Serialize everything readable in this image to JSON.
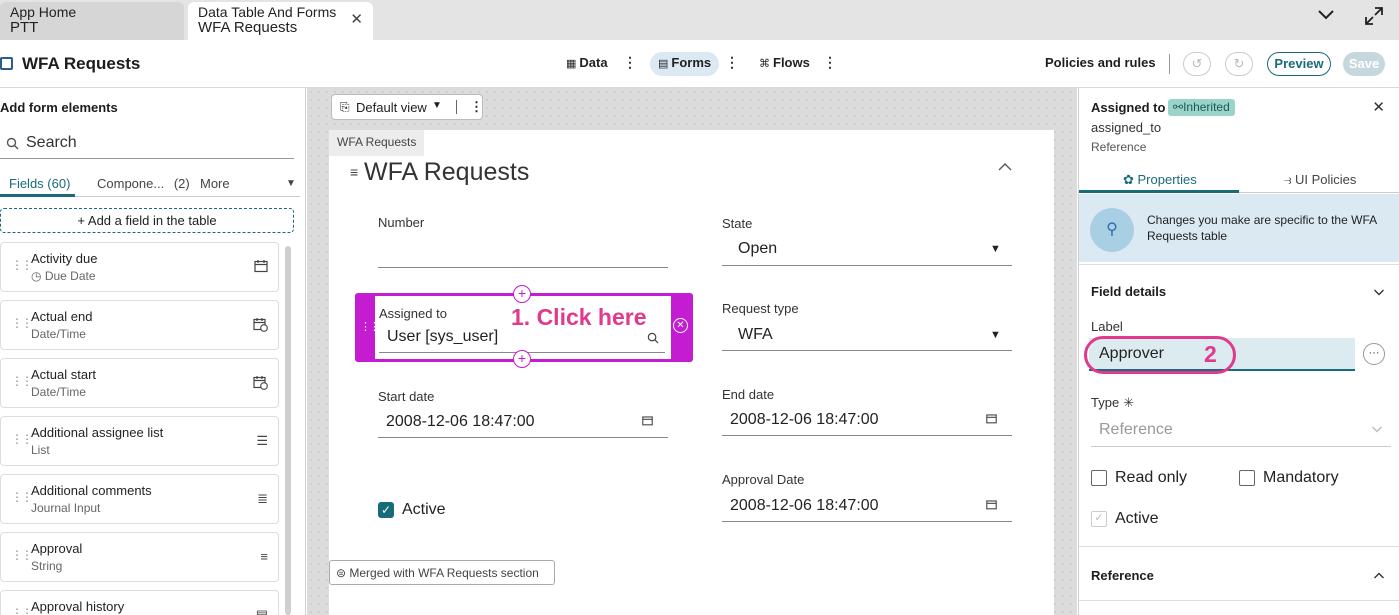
{
  "tabs": [
    {
      "line1": "App Home",
      "line2": "PTT"
    },
    {
      "line1": "Data Table And Forms",
      "line2": "WFA Requests"
    }
  ],
  "header": {
    "title": "WFA Requests",
    "nav": [
      {
        "label": "Data",
        "icon": "table-icon"
      },
      {
        "label": "Forms",
        "icon": "form-icon"
      },
      {
        "label": "Flows",
        "icon": "flow-icon"
      }
    ],
    "policies": "Policies and rules",
    "preview": "Preview",
    "save": "Save"
  },
  "left_panel": {
    "title": "Add form elements",
    "search_placeholder": "Search",
    "tabs": {
      "fields": "Fields (60)",
      "components": "Compone...",
      "components_count": "(2)",
      "more": "More"
    },
    "add_field": "+ Add a field in the table",
    "items": [
      {
        "name": "Activity due",
        "type": "Due Date",
        "icon": "calendar-icon"
      },
      {
        "name": "Actual end",
        "type": "Date/Time",
        "icon": "calendar-clock-icon"
      },
      {
        "name": "Actual start",
        "type": "Date/Time",
        "icon": "calendar-clock-icon"
      },
      {
        "name": "Additional assignee list",
        "type": "List",
        "icon": "list-icon"
      },
      {
        "name": "Additional comments",
        "type": "Journal Input",
        "icon": "journal-icon"
      },
      {
        "name": "Approval",
        "type": "String",
        "icon": "text-icon"
      },
      {
        "name": "Approval history",
        "type": "",
        "icon": "history-icon"
      }
    ]
  },
  "canvas": {
    "view": "Default view",
    "form_tag": "WFA Requests",
    "section_title": "WFA Requests",
    "fields": {
      "number_label": "Number",
      "state_label": "State",
      "state_value": "Open",
      "assigned_label": "Assigned to",
      "assigned_value": "User [sys_user]",
      "request_type_label": "Request type",
      "request_type_value": "WFA",
      "start_label": "Start date",
      "start_value": "2008-12-06 18:47:00",
      "end_label": "End date",
      "end_value": "2008-12-06 18:47:00",
      "approval_label": "Approval Date",
      "approval_value": "2008-12-06 18:47:00",
      "active_label": "Active"
    },
    "annotation_1": "1. Click here",
    "merged": "Merged with WFA Requests section"
  },
  "right_panel": {
    "title": "Assigned to",
    "badge": "Inherited",
    "field_name": "assigned_to",
    "field_type": "Reference",
    "tabs": {
      "properties": "Properties",
      "ui_policies": "UI Policies"
    },
    "info": "Changes you make are specific to the WFA Requests table",
    "field_details": "Field details",
    "label_caption": "Label",
    "label_value": "Approver",
    "annotation_2": "2",
    "type_caption": "Type",
    "type_value": "Reference",
    "read_only": "Read only",
    "mandatory": "Mandatory",
    "active": "Active",
    "reference_section": "Reference"
  },
  "colors": {
    "accent": "#1a6b7a",
    "selection": "#c41cd1",
    "annotation": "#e0398e"
  }
}
